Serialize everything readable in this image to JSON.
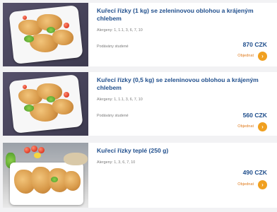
{
  "products": [
    {
      "title": "Kuřecí řízky (1 kg) se zeleninovou oblohou a krájeným chlebem",
      "allergens": "Alergeny: 1, 1.1, 3, 6, 7, 10",
      "note": "Podávány studené",
      "price": "870 CZK",
      "order_label": "Objednat",
      "image_icon": "chicken-schnitzel-plate"
    },
    {
      "title": "Kuřecí řízky (0,5 kg) se zeleninovou oblohou a krájeným chlebem",
      "allergens": "Alergeny: 1, 1.1, 3, 6, 7, 10",
      "note": "Podávány studené",
      "price": "560 CZK",
      "order_label": "Objednat",
      "image_icon": "chicken-schnitzel-plate"
    },
    {
      "title": "Kuřecí řízky teplé (250 g)",
      "allergens": "Alergeny: 1, 3, 6, 7, 10",
      "price": "490 CZK",
      "order_label": "Objednat",
      "image_icon": "chicken-schnitzel-bowl"
    }
  ],
  "colors": {
    "title": "#1f4e8c",
    "accent": "#f0a020",
    "order_text": "#e07a1a",
    "muted": "#7a7a7a"
  }
}
